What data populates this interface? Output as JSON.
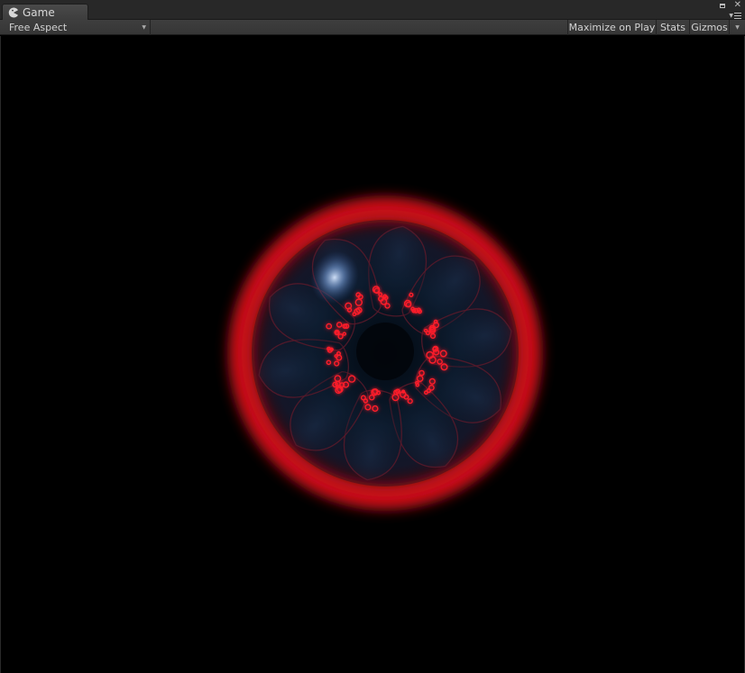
{
  "window": {
    "tab_label": "Game",
    "tab_icon": "unity-pacman-icon",
    "maximize_glyph": "▫",
    "close_glyph": "✕"
  },
  "toolbar": {
    "aspect_label": "Free Aspect",
    "dropdown_glyph": "▼",
    "maximize_on_play_label": "Maximize on Play",
    "stats_label": "Stats",
    "gizmos_label": "Gizmos",
    "gizmos_arrow_glyph": "▼"
  },
  "scene": {
    "object": "glowing-red-orb",
    "colors": {
      "ring": "#e0101a",
      "inner": "#0a1422",
      "petal_outline": "#5a1a2a",
      "sparks": "#ff1e2a",
      "highlight": "#b8d4ff"
    }
  }
}
